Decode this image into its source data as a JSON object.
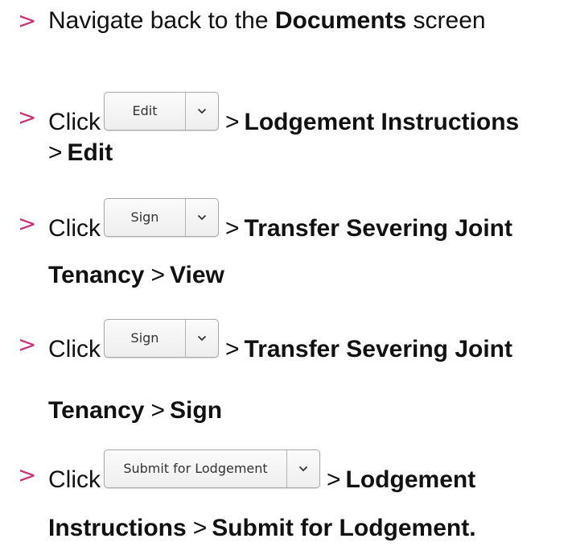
{
  "steps": [
    {
      "bullet": ">",
      "text_before": "Navigate back to the ",
      "bold": "Documents",
      "text_after": " screen"
    },
    {
      "bullet": ">",
      "click": "Click",
      "button_label": "Edit",
      "path": [
        ">",
        "Lodgement Instructions",
        ">",
        "Edit"
      ]
    },
    {
      "bullet": ">",
      "click": "Click",
      "button_label": "Sign",
      "path": [
        ">",
        "Transfer Severing Joint",
        "Tenancy",
        ">",
        "View"
      ]
    },
    {
      "bullet": ">",
      "click": "Click",
      "button_label": "Sign",
      "path": [
        ">",
        "Transfer Severing Joint",
        "Tenancy",
        ">",
        "Sign"
      ]
    },
    {
      "bullet": ">",
      "click": "Click",
      "button_label": "Submit for Lodgement",
      "path": [
        ">",
        "Lodgement",
        "Instructions",
        ">",
        "Submit for Lodgement."
      ]
    }
  ],
  "icons": {
    "dropdown": "chevron-down-icon"
  },
  "colors": {
    "bullet": "#c4357a",
    "text": "#111111",
    "button_border": "#a9a9a9"
  }
}
